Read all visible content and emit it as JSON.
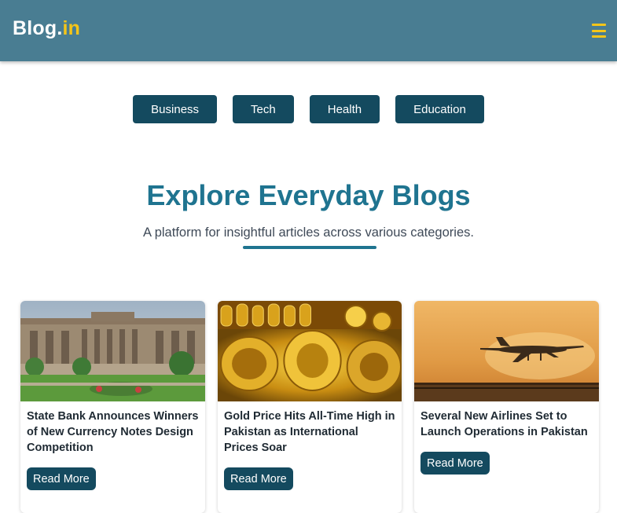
{
  "header": {
    "logo_main": "Blog.",
    "logo_accent": "in",
    "menu_icon": "hamburger-menu-icon",
    "accent_color": "#f5c518",
    "bg_color": "#497d92"
  },
  "categories": [
    "Business",
    "Tech",
    "Health",
    "Education"
  ],
  "hero": {
    "title": "Explore Everyday Blogs",
    "subtitle": "A platform for insightful articles across various categories."
  },
  "posts": [
    {
      "title": "State Bank Announces Winners of New Currency Notes Design Competition",
      "image": "state-bank-building-image",
      "button": "Read More"
    },
    {
      "title": "Gold Price Hits All-Time High in Pakistan as International Prices Soar",
      "image": "gold-jewellery-image",
      "button": "Read More"
    },
    {
      "title": "Several New Airlines Set to Launch Operations in Pakistan",
      "image": "airplane-sunset-image",
      "button": "Read More"
    }
  ]
}
